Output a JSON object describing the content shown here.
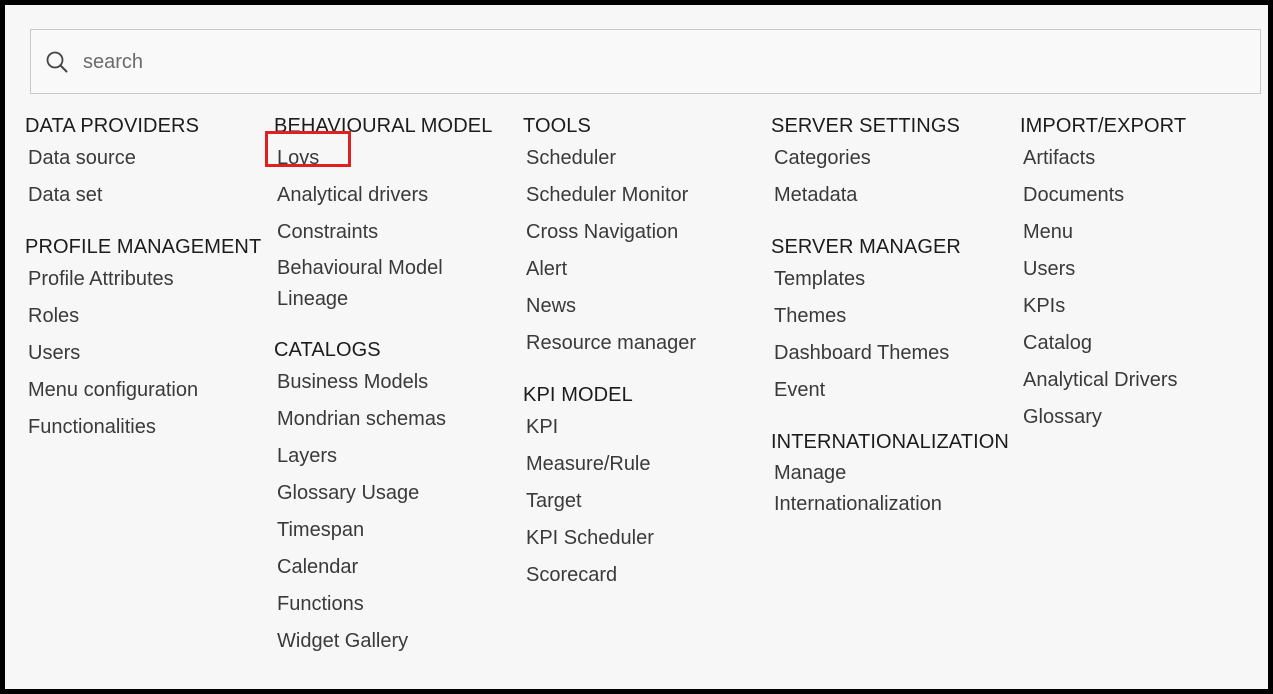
{
  "search": {
    "placeholder": "search",
    "icon": "search-icon"
  },
  "colors": {
    "highlight": "#e02020",
    "background": "#f7f7f7",
    "border": "#000000"
  },
  "columns": [
    {
      "sections": [
        {
          "title": "DATA PROVIDERS",
          "items": [
            "Data source",
            "Data set"
          ]
        },
        {
          "title": "PROFILE MANAGEMENT",
          "items": [
            "Profile Attributes",
            "Roles",
            "Users",
            "Menu configuration",
            "Functionalities"
          ]
        }
      ]
    },
    {
      "sections": [
        {
          "title": "BEHAVIOURAL MODEL",
          "items": [
            "Lovs",
            "Analytical drivers",
            "Constraints",
            "Behavioural Model Lineage"
          ]
        },
        {
          "title": "CATALOGS",
          "items": [
            "Business Models",
            "Mondrian schemas",
            "Layers",
            "Glossary Usage",
            "Timespan",
            "Calendar",
            "Functions",
            "Widget Gallery"
          ]
        }
      ]
    },
    {
      "sections": [
        {
          "title": "TOOLS",
          "items": [
            "Scheduler",
            "Scheduler Monitor",
            "Cross Navigation",
            "Alert",
            "News",
            "Resource manager"
          ]
        },
        {
          "title": "KPI MODEL",
          "items": [
            "KPI",
            "Measure/Rule",
            "Target",
            "KPI Scheduler",
            "Scorecard"
          ]
        }
      ]
    },
    {
      "sections": [
        {
          "title": "SERVER SETTINGS",
          "items": [
            "Categories",
            "Metadata"
          ]
        },
        {
          "title": "SERVER MANAGER",
          "items": [
            "Templates",
            "Themes",
            "Dashboard Themes",
            "Event"
          ]
        },
        {
          "title": "INTERNATIONALIZATION",
          "items": [
            "Manage Internationalization"
          ]
        }
      ]
    },
    {
      "sections": [
        {
          "title": "IMPORT/EXPORT",
          "items": [
            "Artifacts",
            "Documents",
            "Menu",
            "Users",
            "KPIs",
            "Catalog",
            "Analytical Drivers",
            "Glossary"
          ]
        }
      ]
    }
  ],
  "highlighted_item": "Lovs"
}
